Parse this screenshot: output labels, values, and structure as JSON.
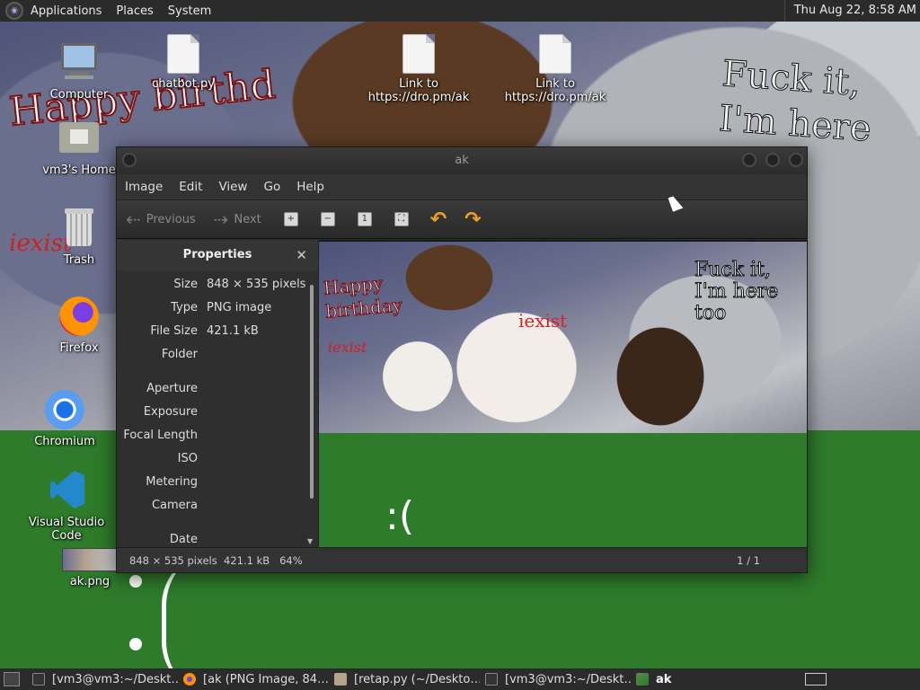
{
  "top_panel": {
    "menus": [
      "Applications",
      "Places",
      "System"
    ],
    "clock": "Thu Aug 22,  8:58 AM"
  },
  "wallpaper": {
    "happy_text": "Happy birthd",
    "fuck_text": "Fuck it, I'm here too",
    "iexist_text": "iexist"
  },
  "desktop_icons": [
    {
      "label": "Computer",
      "icon": "computer-icon"
    },
    {
      "label": "chatbot.py",
      "icon": "python-file-icon"
    },
    {
      "label": "Link to https://dro.pm/ak",
      "icon": "text-file-icon"
    },
    {
      "label": "Link to https://dro.pm/ak",
      "icon": "text-file-icon"
    },
    {
      "label": "vm3's Home",
      "icon": "home-folder-icon"
    },
    {
      "label": "Trash",
      "icon": "trash-icon"
    },
    {
      "label": "Firefox",
      "icon": "firefox-icon"
    },
    {
      "label": "Chromium",
      "icon": "chromium-icon"
    },
    {
      "label": "Visual Studio Code",
      "icon": "vscode-icon"
    },
    {
      "label": "ak.png",
      "icon": "image-file-icon"
    }
  ],
  "viewer": {
    "title": "ak",
    "menu": [
      "Image",
      "Edit",
      "View",
      "Go",
      "Help"
    ],
    "toolbar": {
      "previous": "Previous",
      "next": "Next"
    },
    "properties": {
      "header": "Properties",
      "close": "✕",
      "rows": [
        {
          "key": "Size",
          "value": "848 × 535 pixels"
        },
        {
          "key": "Type",
          "value": "PNG image"
        },
        {
          "key": "File Size",
          "value": "421.1 kB"
        },
        {
          "key": "Folder",
          "value": ""
        },
        {
          "key": "Aperture",
          "value": ""
        },
        {
          "key": "Exposure",
          "value": ""
        },
        {
          "key": "Focal Length",
          "value": ""
        },
        {
          "key": "ISO",
          "value": ""
        },
        {
          "key": "Metering",
          "value": ""
        },
        {
          "key": "Camera",
          "value": ""
        },
        {
          "key": "Date",
          "value": ""
        }
      ]
    },
    "image": {
      "happy_text": "Happy birthday",
      "fuck_text": "Fuck it, I'm here too",
      "iexist_text": "iexist",
      "iexist2_text": "iexist",
      "sad_text": ":("
    },
    "status": {
      "info": "848 × 535 pixels  421.1 kB   64%",
      "page": "1 / 1"
    }
  },
  "taskbar": {
    "tasks": [
      {
        "label": "[vm3@vm3:~/Deskt…",
        "icon": "terminal-icon"
      },
      {
        "label": "[ak (PNG Image, 84…",
        "icon": "firefox-icon"
      },
      {
        "label": "[retap.py (~/Deskto…",
        "icon": "editor-icon"
      },
      {
        "label": "[vm3@vm3:~/Deskt…",
        "icon": "terminal-icon"
      },
      {
        "label": "ak",
        "icon": "image-viewer-icon"
      }
    ]
  },
  "colors": {
    "panel_bg": "#2b2b2b",
    "desktop_green": "#2e7b2b",
    "accent_orange": "#f0a020",
    "iexist_red": "#d02020"
  }
}
